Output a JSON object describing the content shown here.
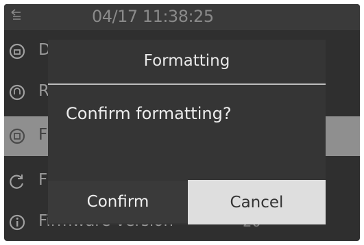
{
  "status_bar": {
    "datetime": "04/17 11:38:25",
    "icon": "back-icon"
  },
  "menu": {
    "items": [
      {
        "icon": "lock-circle-icon",
        "label_partial": "D"
      },
      {
        "icon": "shield-circle-icon",
        "label_partial": "R"
      },
      {
        "icon": "storage-circle-icon",
        "label_partial": "F",
        "selected": true
      },
      {
        "icon": "refresh-circle-icon",
        "label_partial": "F"
      },
      {
        "icon": "info-icon",
        "label": "Firmware version",
        "value": "20"
      }
    ]
  },
  "dialog": {
    "title": "Formatting",
    "message": "Confirm formatting?",
    "confirm_label": "Confirm",
    "cancel_label": "Cancel"
  },
  "colors": {
    "screen_bg": "#2f2f2f",
    "dialog_bg": "#353535",
    "selected_row": "#8f8f8f",
    "cancel_bg": "#dedede"
  }
}
